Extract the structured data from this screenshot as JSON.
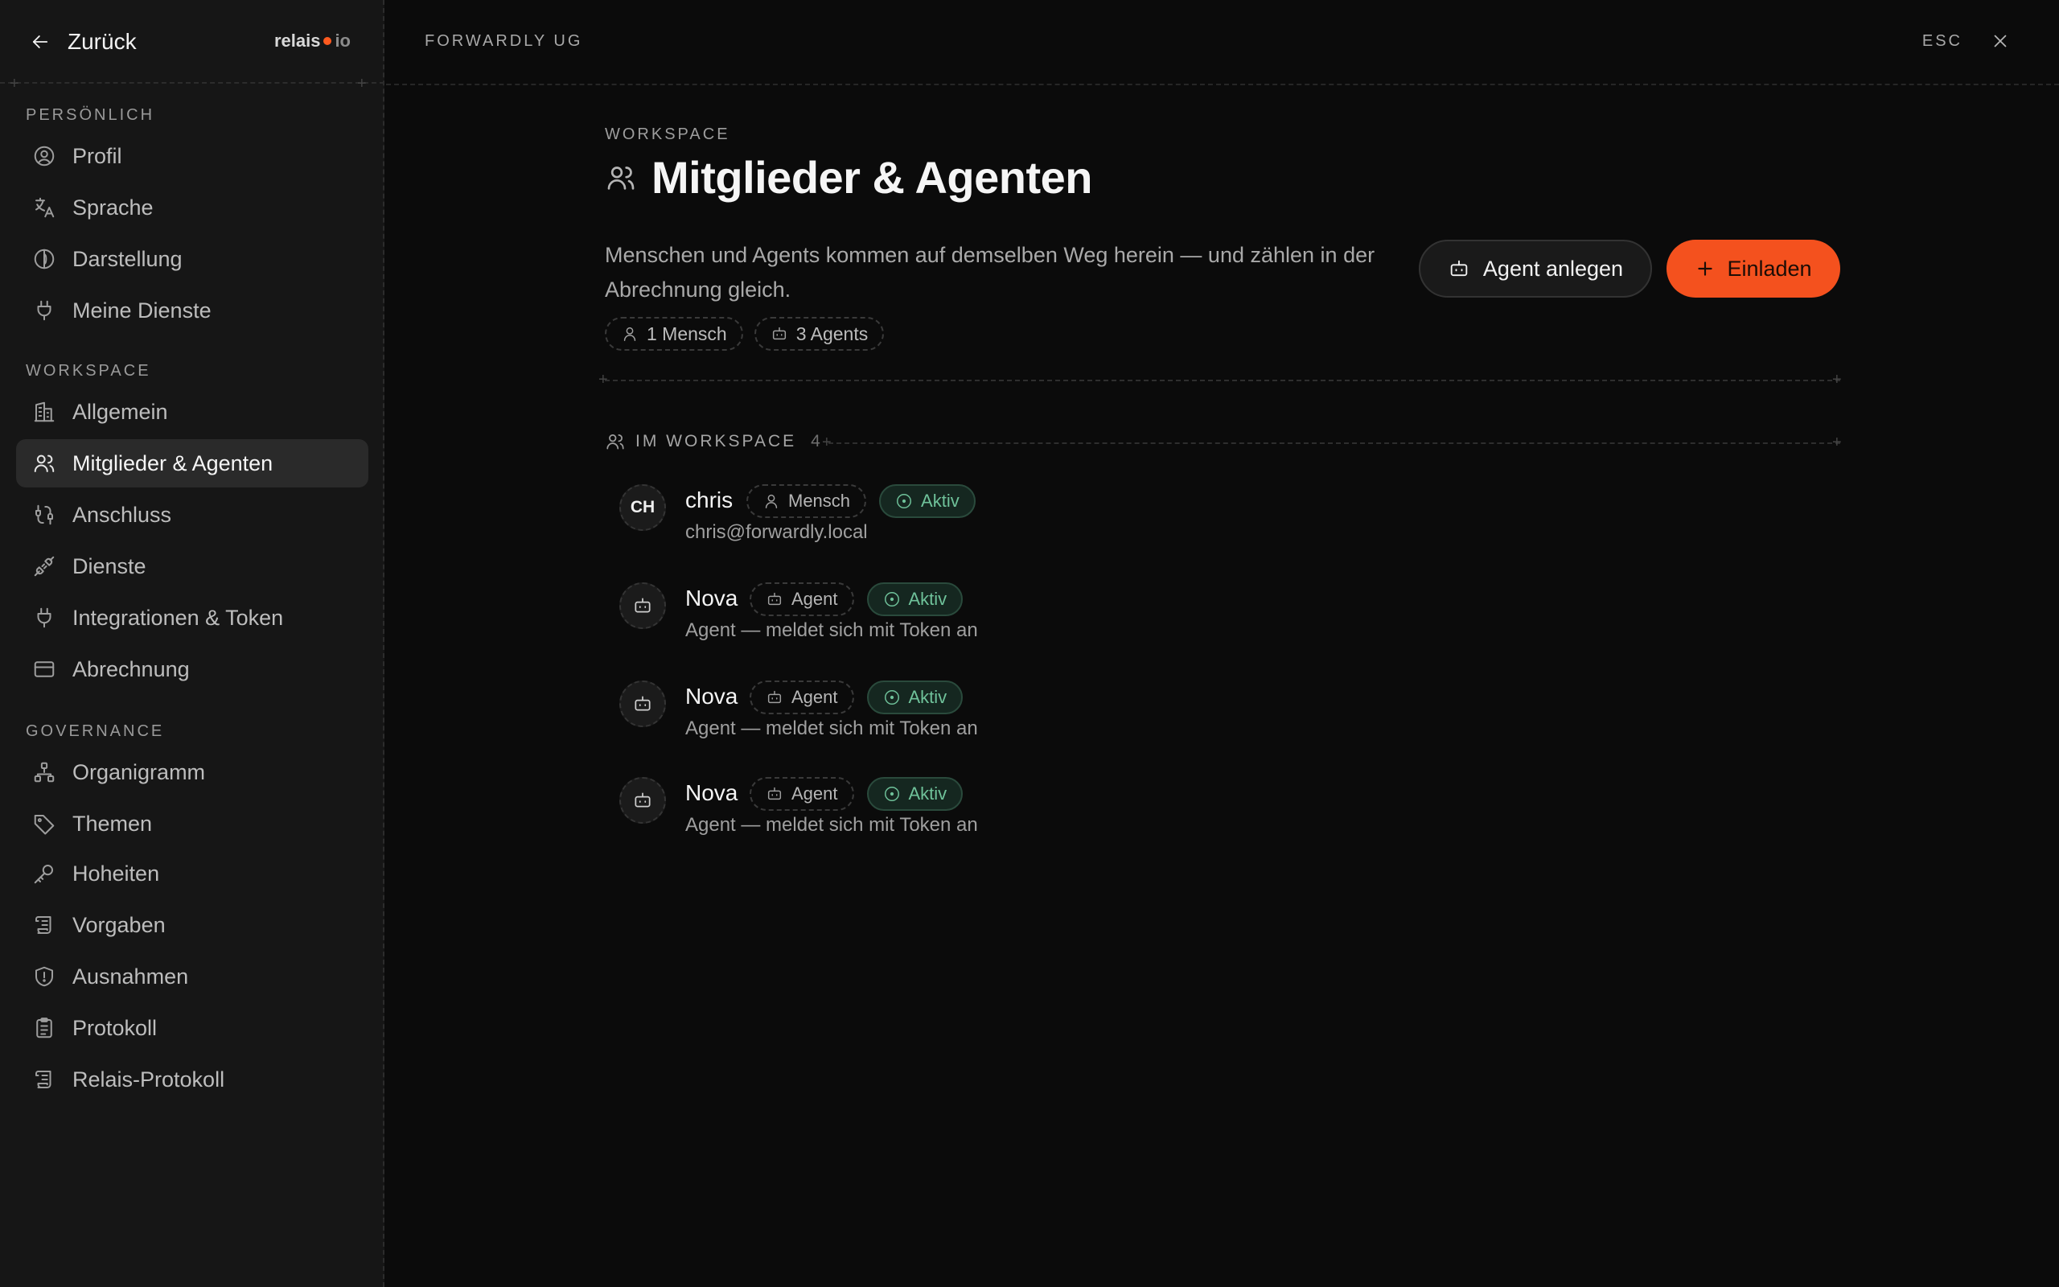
{
  "sidebar": {
    "back_label": "Zurück",
    "brand": {
      "name": "relais",
      "suffix": "io",
      "accent": "#ff5a1f"
    },
    "sections": [
      {
        "title": "PERSÖNLICH",
        "items": [
          {
            "label": "Profil",
            "icon": "user-circle-icon"
          },
          {
            "label": "Sprache",
            "icon": "translate-icon"
          },
          {
            "label": "Darstellung",
            "icon": "contrast-icon"
          },
          {
            "label": "Meine Dienste",
            "icon": "plug-icon"
          }
        ]
      },
      {
        "title": "WORKSPACE",
        "items": [
          {
            "label": "Allgemein",
            "icon": "building-icon"
          },
          {
            "label": "Mitglieder & Agenten",
            "icon": "users-icon",
            "active": true
          },
          {
            "label": "Anschluss",
            "icon": "connection-icon"
          },
          {
            "label": "Dienste",
            "icon": "plug-connected-icon"
          },
          {
            "label": "Integrationen & Token",
            "icon": "plug-icon"
          },
          {
            "label": "Abrechnung",
            "icon": "credit-card-icon"
          }
        ]
      },
      {
        "title": "GOVERNANCE",
        "items": [
          {
            "label": "Organigramm",
            "icon": "sitemap-icon"
          },
          {
            "label": "Themen",
            "icon": "tag-icon"
          },
          {
            "label": "Hoheiten",
            "icon": "key-icon"
          },
          {
            "label": "Vorgaben",
            "icon": "scroll-icon"
          },
          {
            "label": "Ausnahmen",
            "icon": "shield-icon"
          },
          {
            "label": "Protokoll",
            "icon": "clipboard-icon"
          },
          {
            "label": "Relais-Protokoll",
            "icon": "scroll-icon"
          }
        ]
      }
    ]
  },
  "header": {
    "org_name": "FORWARDLY UG",
    "esc_label": "ESC"
  },
  "main": {
    "eyebrow": "WORKSPACE",
    "title": "Mitglieder & Agenten",
    "description": "Menschen und Agents kommen auf demselben Weg herein — und zählen in der Abrechnung gleich.",
    "chips": {
      "humans": "1 Mensch",
      "agents": "3 Agents"
    },
    "buttons": {
      "create_agent": "Agent anlegen",
      "invite": "Einladen"
    },
    "list": {
      "heading": "IM WORKSPACE",
      "count": "4",
      "members": [
        {
          "avatar": "CH",
          "name": "chris",
          "type": "Mensch",
          "status": "Aktiv",
          "subtitle": "chris@forwardly.local"
        },
        {
          "avatar": "",
          "name": "Nova",
          "type": "Agent",
          "status": "Aktiv",
          "subtitle": "Agent — meldet sich mit Token an"
        },
        {
          "avatar": "",
          "name": "Nova",
          "type": "Agent",
          "status": "Aktiv",
          "subtitle": "Agent — meldet sich mit Token an"
        },
        {
          "avatar": "",
          "name": "Nova",
          "type": "Agent",
          "status": "Aktiv",
          "subtitle": "Agent — meldet sich mit Token an"
        }
      ]
    }
  },
  "colors": {
    "accent": "#f4511e",
    "status_active": "#6fc29a",
    "background": "#0b0b0b",
    "sidebar": "#161616"
  }
}
